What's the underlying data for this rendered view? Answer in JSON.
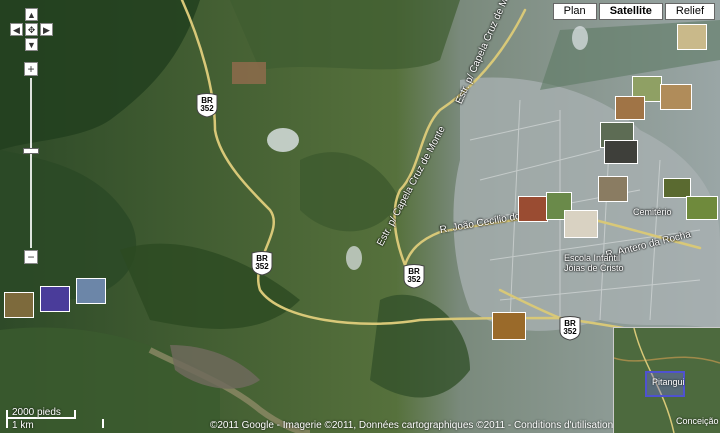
{
  "map_types": {
    "plan": "Plan",
    "satellite": "Satellite",
    "relief": "Relief",
    "active": "satellite"
  },
  "roads": {
    "shield_label": "BR",
    "shield_number": "352",
    "capela_1": "Estr. p/ Capela Cruz de Monte",
    "capela_2": "Estr. p/ Capela Cruz de Monte",
    "capela_3": "Estr. p/ Capela Cruz de Monte",
    "joao": "R. João Cecílio dos",
    "antero": "R. Antero da Rocha"
  },
  "places": {
    "escola_1": "Escola Infantil",
    "escola_2": "Jóias de Cristo",
    "cemiterio": "Cemitério",
    "pitangui": "Pitangui",
    "conceicao": "Conceição"
  },
  "scale": {
    "imperial": "2000 pieds",
    "metric": "1 km"
  },
  "copyright": "©2011 Google - Imagerie ©2011, Données cartographiques ©2011 - Conditions d'utilisation",
  "colors": {
    "road": "#d8c878",
    "overview_box": "#4f52d0"
  },
  "icons": {
    "pan_up": "▲",
    "pan_down": "▼",
    "pan_left": "◀",
    "pan_right": "▶",
    "center": "✥",
    "zoom_in": "+",
    "zoom_out": "−"
  }
}
